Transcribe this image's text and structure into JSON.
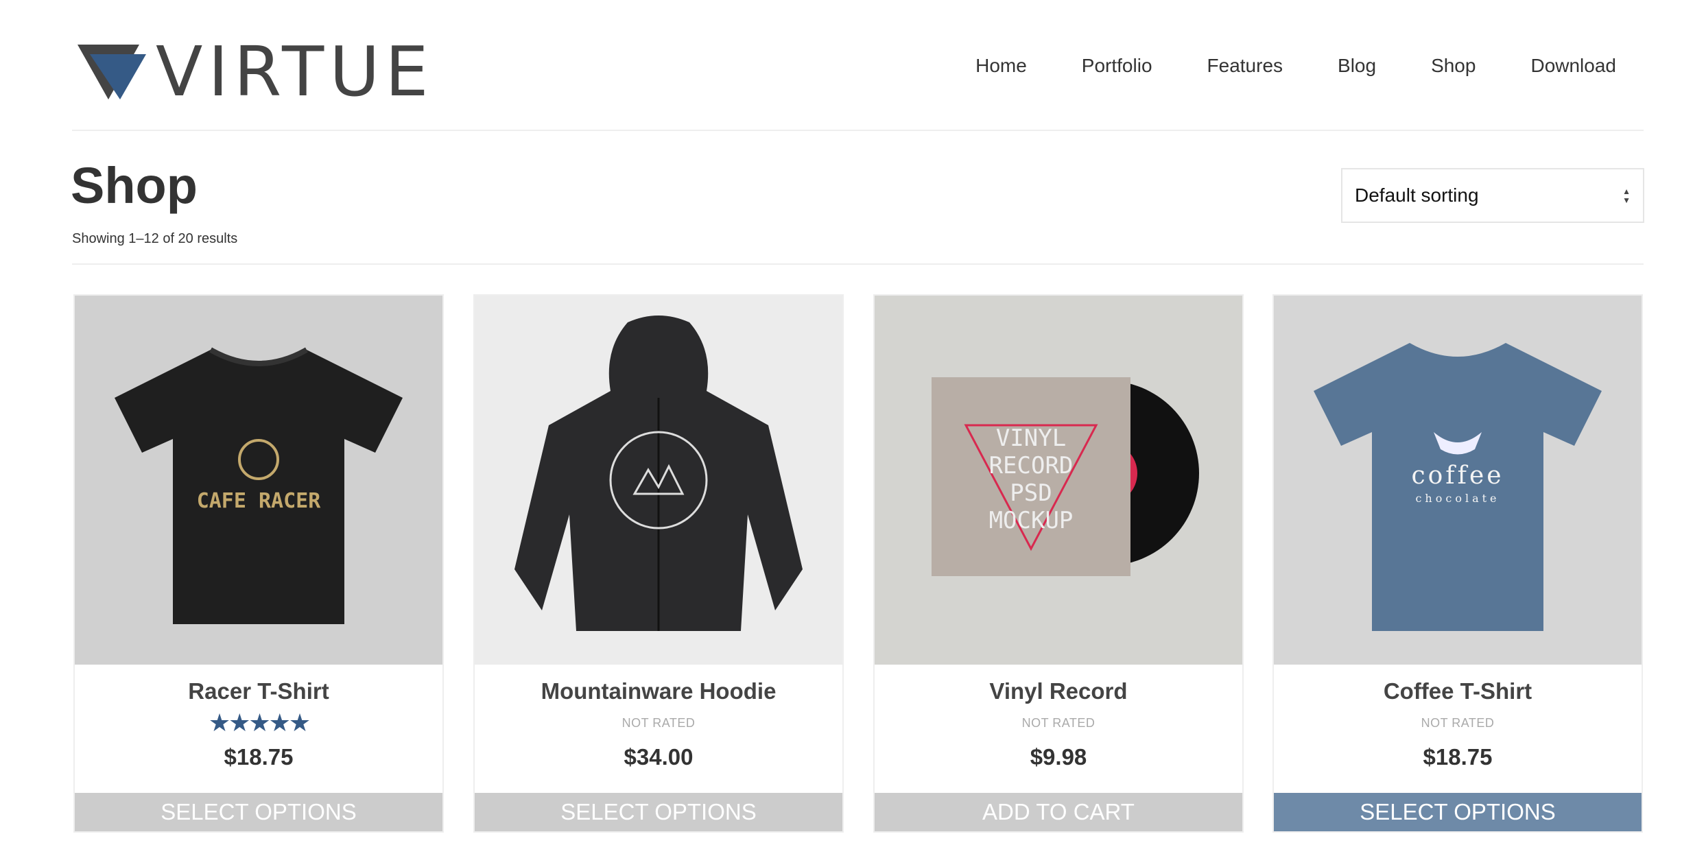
{
  "brand": {
    "name": "VIRTUE",
    "accent": "#355a86"
  },
  "nav": [
    "Home",
    "Portfolio",
    "Features",
    "Blog",
    "Shop",
    "Download"
  ],
  "page": {
    "title": "Shop",
    "result_count": "Showing 1–12 of 20 results"
  },
  "sorting": {
    "selected": "Default sorting"
  },
  "products": [
    {
      "name": "Racer T-Shirt",
      "rating": 5,
      "rating_text": "★★★★★",
      "price": "$18.75",
      "button": "SELECT OPTIONS",
      "image_bg": "#d0d0d0"
    },
    {
      "name": "Mountainware Hoodie",
      "rating_text": "NOT RATED",
      "price": "$34.00",
      "button": "SELECT OPTIONS",
      "image_bg": "#ececec"
    },
    {
      "name": "Vinyl Record",
      "rating_text": "NOT RATED",
      "price": "$9.98",
      "button": "ADD TO CART",
      "image_bg": "#d4d4d0"
    },
    {
      "name": "Coffee T-Shirt",
      "rating_text": "NOT RATED",
      "price": "$18.75",
      "button": "SELECT OPTIONS",
      "image_bg": "#d6d6d6"
    }
  ],
  "colors": {
    "button": "#cccccc",
    "button_hover": "#6e8aa8",
    "star": "#355a86"
  }
}
